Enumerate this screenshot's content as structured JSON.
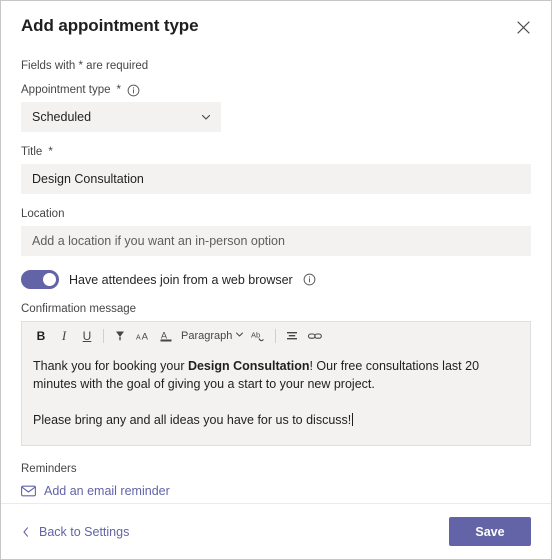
{
  "dialog": {
    "title": "Add appointment type",
    "close_icon": "close-icon",
    "required_note": "Fields with * are required"
  },
  "form": {
    "appointment_type": {
      "label": "Appointment type",
      "required_marker": "*",
      "info_icon": "info-circle-icon",
      "value": "Scheduled",
      "chevron_icon": "chevron-down-icon"
    },
    "title": {
      "label": "Title",
      "required_marker": "*",
      "value": "Design Consultation"
    },
    "location": {
      "label": "Location",
      "placeholder": "Add a location if you want an in-person option",
      "value": ""
    },
    "web_browser_toggle": {
      "label": "Have attendees join from a web browser",
      "state": "on",
      "info_icon": "info-circle-icon"
    },
    "confirmation_message": {
      "label": "Confirmation message",
      "toolbar": [
        {
          "name": "bold-icon",
          "label": "B"
        },
        {
          "name": "italic-icon",
          "label": "I"
        },
        {
          "name": "underline-icon",
          "label": "U"
        },
        {
          "name": "highlight-icon",
          "label": ""
        },
        {
          "name": "font-size-icon",
          "label": "AA"
        },
        {
          "name": "font-color-icon",
          "label": "A"
        },
        {
          "name": "paragraph-style-dropdown",
          "label": "Paragraph"
        },
        {
          "name": "spell-check-icon",
          "label": "Ab"
        },
        {
          "name": "align-icon",
          "label": ""
        },
        {
          "name": "link-icon",
          "label": ""
        }
      ],
      "paragraph_label": "Paragraph",
      "body_line1_pre": "Thank you for booking your ",
      "body_line1_bold": "Design Consultation",
      "body_line1_post": "! Our free consultations last 20 minutes with the goal of giving you a start to your new project.",
      "body_line2": "Please bring any and all ideas you have for us to discuss!"
    }
  },
  "reminders": {
    "label": "Reminders",
    "add_link": "Add an email reminder",
    "mail_icon": "mail-icon"
  },
  "footer": {
    "back_label": "Back to Settings",
    "back_chevron_icon": "chevron-left-icon",
    "save_label": "Save"
  },
  "colors": {
    "accent": "#6264a7",
    "field_bg": "#f3f2f1",
    "text": "#201f1e",
    "muted_text": "#484644"
  }
}
